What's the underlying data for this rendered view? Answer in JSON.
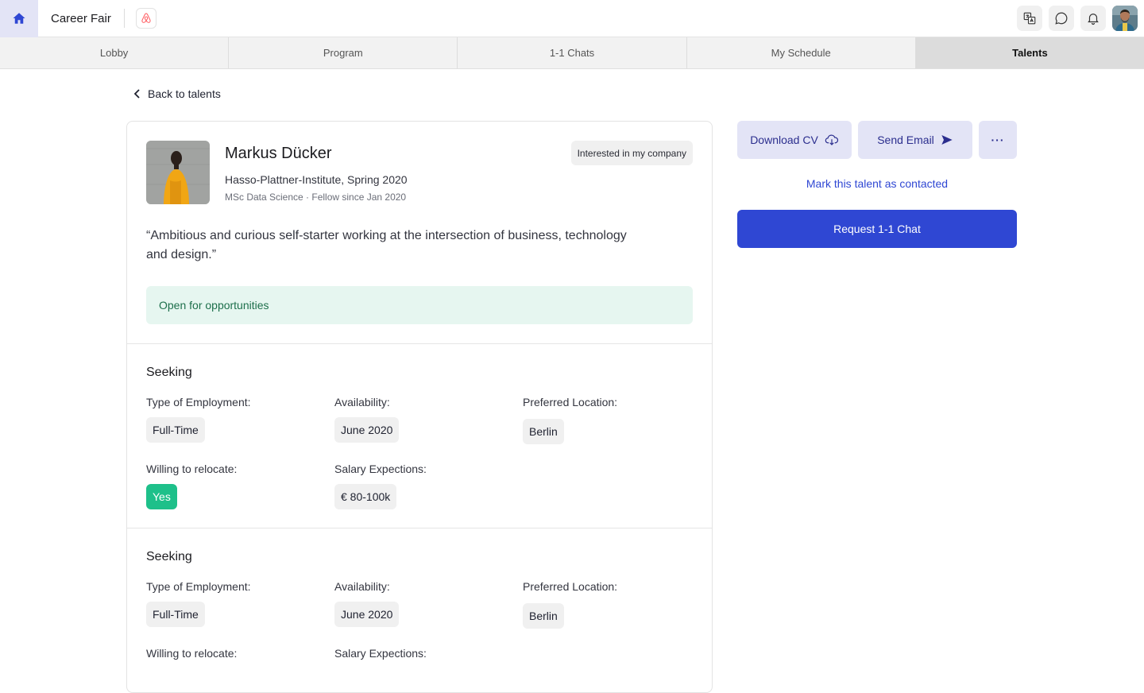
{
  "app": {
    "title": "Career Fair"
  },
  "tabs": [
    {
      "label": "Lobby"
    },
    {
      "label": "Program"
    },
    {
      "label": "1-1 Chats"
    },
    {
      "label": "My Schedule"
    },
    {
      "label": "Talents"
    }
  ],
  "back": {
    "label": "Back to talents"
  },
  "profile": {
    "name": "Markus Dücker",
    "school": "Hasso-Plattner-Institute, Spring 2020",
    "meta": "MSc Data Science · Fellow since Jan 2020",
    "badge": "Interested in my company",
    "quote": "“Ambitious and curious self-starter working at the intersection of business, technology and design.”",
    "status": "Open for opportunities"
  },
  "sections": [
    {
      "title": "Seeking",
      "employment_label": "Type of Employment:",
      "employment": "Full-Time",
      "availability_label": "Availability:",
      "availability": "June 2020",
      "location_label": "Preferred Location:",
      "location": "Berlin",
      "relocate_label": "Willing to relocate:",
      "relocate": "Yes",
      "salary_label": "Salary Expections:",
      "salary": "€ 80-100k"
    },
    {
      "title": "Seeking",
      "employment_label": "Type of Employment:",
      "employment": "Full-Time",
      "availability_label": "Availability:",
      "availability": "June 2020",
      "location_label": "Preferred Location:",
      "location": "Berlin",
      "relocate_label": "Willing to relocate:",
      "salary_label": "Salary Expections:"
    }
  ],
  "actions": {
    "download_cv": "Download CV",
    "send_email": "Send Email",
    "more": "···",
    "mark_contacted": "Mark this talent as contacted",
    "request_chat": "Request 1-1 Chat"
  },
  "colors": {
    "primary": "#2f47d3",
    "soft": "#e3e4f6",
    "success": "#1ec08a",
    "banner": "#e6f6f0"
  }
}
